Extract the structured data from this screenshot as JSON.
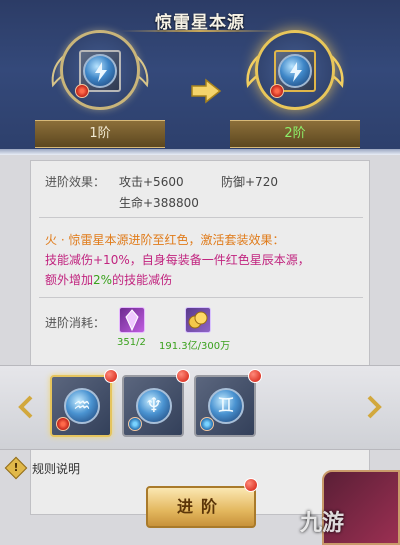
{
  "header": {
    "title": "惊雷星本源"
  },
  "stages": [
    {
      "label": "1阶"
    },
    {
      "label": "2阶"
    }
  ],
  "stats": {
    "label": "进阶效果：",
    "attack": "攻击+5600",
    "defense": "防御+720",
    "hp": "生命+388800"
  },
  "set_effect": {
    "line1": "火 · 惊雷星本源进阶至红色，激活套装效果：",
    "line2_a": "技能减伤+10%",
    "line2_b": "，自身每装备一件红色星辰本源，",
    "line3_a": "额外增加",
    "line3_b": "2%",
    "line3_c": "的技能减伤"
  },
  "cost": {
    "label": "进阶消耗：",
    "items": [
      {
        "icon": "purple-crystal-icon",
        "count": "351/2"
      },
      {
        "icon": "gold-coins-icon",
        "count": "191.3亿/300万"
      }
    ]
  },
  "slots": [
    {
      "glyph": "♒",
      "element": "fire",
      "active": true
    },
    {
      "glyph": "♆",
      "element": "water",
      "active": false
    },
    {
      "glyph": "♊",
      "element": "water",
      "active": false
    }
  ],
  "footer": {
    "rules_label": "规则说明",
    "advance_label": "进阶",
    "watermark": "九游"
  },
  "colors": {
    "accent_green": "#3aa11d",
    "accent_orange": "#e07b1a",
    "accent_pink": "#c1247f",
    "gold": "#e3b75e"
  }
}
